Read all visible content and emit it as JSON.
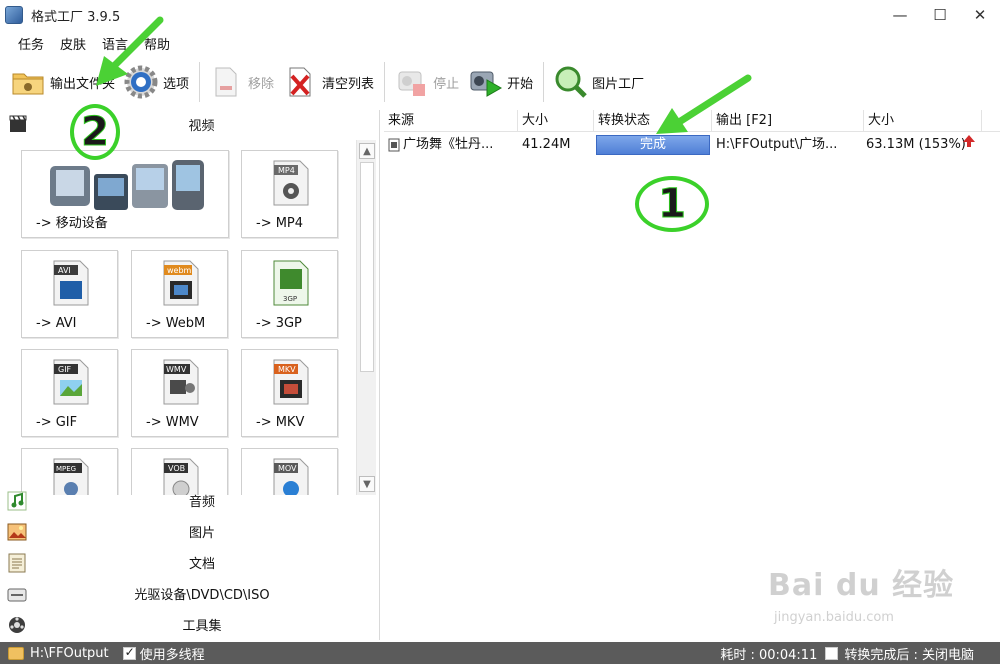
{
  "window": {
    "title": "格式工厂 3.9.5",
    "minimize": "—",
    "maximize": "☐",
    "close": "✕"
  },
  "menu": [
    "任务",
    "皮肤",
    "语言",
    "帮助"
  ],
  "toolbar": {
    "output_folder": "输出文件夹",
    "options": "选项",
    "remove": "移除",
    "clear_list": "清空列表",
    "stop": "停止",
    "start": "开始",
    "picture_factory": "图片工厂"
  },
  "left_panel": {
    "video_label": "视频",
    "tiles": [
      {
        "label": "-> 移动设备"
      },
      {
        "label": "-> MP4",
        "badge": "MP4"
      },
      {
        "label": "-> AVI",
        "badge": "AVI"
      },
      {
        "label": "-> WebM",
        "badge": "webm"
      },
      {
        "label": "-> 3GP",
        "badge": "3GP"
      },
      {
        "label": "-> GIF",
        "badge": "GIF"
      },
      {
        "label": "-> WMV",
        "badge": "WMV"
      },
      {
        "label": "-> MKV",
        "badge": "MKV"
      },
      {
        "label": "",
        "badge": "MPEG"
      },
      {
        "label": "",
        "badge": "VOB"
      },
      {
        "label": "",
        "badge": "MOV"
      }
    ],
    "categories": [
      "音频",
      "图片",
      "文档",
      "光驱设备\\DVD\\CD\\ISO",
      "工具集"
    ]
  },
  "file_list": {
    "columns": [
      "来源",
      "大小",
      "转换状态",
      "输出 [F2]",
      "大小"
    ],
    "rows": [
      {
        "source": "广场舞《牡丹...",
        "size": "41.24M",
        "status": "完成",
        "output": "H:\\FFOutput\\广场...",
        "out_size": "63.13M  (153%)"
      }
    ]
  },
  "annotations": {
    "one": "1",
    "two": "2"
  },
  "statusbar": {
    "folder": "H:\\FFOutput",
    "multithread": "使用多线程",
    "elapsed": "耗时 : 00:04:11",
    "after_done": "转换完成后 : 关闭电脑"
  },
  "watermark": {
    "brand": "Bai du 经验",
    "url": "jingyan.baidu.com"
  },
  "colors": {
    "status_done": "#4f7fd6",
    "annotation_green": "#3bd12a",
    "statusbar_bg": "#5b5b5b"
  }
}
